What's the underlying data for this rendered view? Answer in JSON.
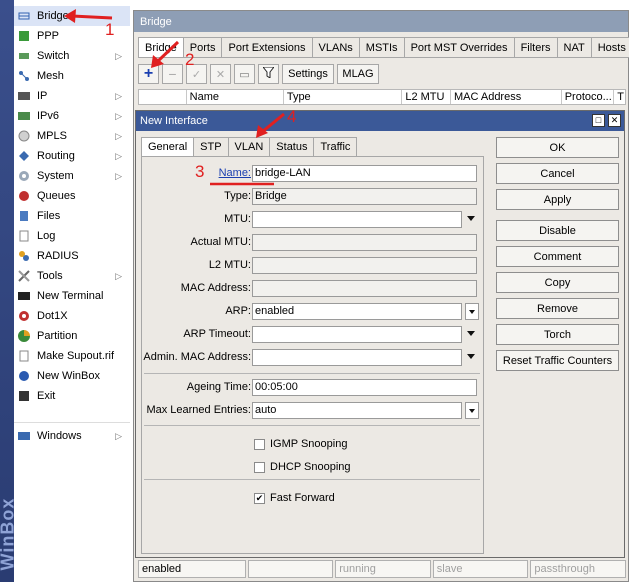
{
  "strip": {
    "brand": "WinBox"
  },
  "menu": {
    "items": [
      {
        "label": "Bridge",
        "icon": "bridge-icon",
        "arrow": false
      },
      {
        "label": "PPP",
        "icon": "ppp-icon",
        "arrow": false
      },
      {
        "label": "Switch",
        "icon": "switch-icon",
        "arrow": true
      },
      {
        "label": "Mesh",
        "icon": "mesh-icon",
        "arrow": false
      },
      {
        "label": "IP",
        "icon": "ip-icon",
        "arrow": true
      },
      {
        "label": "IPv6",
        "icon": "ipv6-icon",
        "arrow": true
      },
      {
        "label": "MPLS",
        "icon": "mpls-icon",
        "arrow": true
      },
      {
        "label": "Routing",
        "icon": "routing-icon",
        "arrow": true
      },
      {
        "label": "System",
        "icon": "system-icon",
        "arrow": true
      },
      {
        "label": "Queues",
        "icon": "queues-icon",
        "arrow": false
      },
      {
        "label": "Files",
        "icon": "files-icon",
        "arrow": false
      },
      {
        "label": "Log",
        "icon": "log-icon",
        "arrow": false
      },
      {
        "label": "RADIUS",
        "icon": "radius-icon",
        "arrow": false
      },
      {
        "label": "Tools",
        "icon": "tools-icon",
        "arrow": true
      },
      {
        "label": "New Terminal",
        "icon": "terminal-icon",
        "arrow": false
      },
      {
        "label": "Dot1X",
        "icon": "dot1x-icon",
        "arrow": false
      },
      {
        "label": "Partition",
        "icon": "partition-icon",
        "arrow": false
      },
      {
        "label": "Make Supout.rif",
        "icon": "supout-icon",
        "arrow": false
      },
      {
        "label": "New WinBox",
        "icon": "winbox-icon",
        "arrow": false
      },
      {
        "label": "Exit",
        "icon": "exit-icon",
        "arrow": false
      }
    ],
    "windows": {
      "label": "Windows",
      "icon": "windows-icon",
      "arrow": true
    }
  },
  "bridge_window": {
    "title": "Bridge",
    "tabs": [
      "Bridge",
      "Ports",
      "Port Extensions",
      "VLANs",
      "MSTIs",
      "Port MST Overrides",
      "Filters",
      "NAT",
      "Hosts"
    ],
    "toolbar": {
      "settings": "Settings",
      "mlag": "MLAG"
    },
    "columns": [
      "",
      "Name",
      "Type",
      "L2 MTU",
      "MAC Address",
      "Protoco...",
      "T"
    ],
    "status": [
      "enabled",
      "",
      "running",
      "slave",
      "passthrough"
    ]
  },
  "dialog": {
    "title": "New Interface",
    "tabs": [
      "General",
      "STP",
      "VLAN",
      "Status",
      "Traffic"
    ],
    "fields": {
      "name": {
        "label": "Name:",
        "value": "bridge-LAN"
      },
      "type": {
        "label": "Type:",
        "value": "Bridge"
      },
      "mtu": {
        "label": "MTU:",
        "value": ""
      },
      "actual_mtu": {
        "label": "Actual MTU:",
        "value": ""
      },
      "l2_mtu": {
        "label": "L2 MTU:",
        "value": ""
      },
      "mac_address": {
        "label": "MAC Address:",
        "value": ""
      },
      "arp": {
        "label": "ARP:",
        "value": "enabled"
      },
      "arp_timeout": {
        "label": "ARP Timeout:",
        "value": ""
      },
      "admin_mac": {
        "label": "Admin. MAC Address:",
        "value": ""
      },
      "ageing_time": {
        "label": "Ageing Time:",
        "value": "00:05:00"
      },
      "max_learned": {
        "label": "Max Learned Entries:",
        "value": "auto"
      }
    },
    "checkboxes": {
      "igmp": {
        "label": "IGMP Snooping",
        "checked": false
      },
      "dhcp": {
        "label": "DHCP Snooping",
        "checked": false
      },
      "fast_forward": {
        "label": "Fast Forward",
        "checked": true
      }
    },
    "buttons": {
      "ok": "OK",
      "cancel": "Cancel",
      "apply": "Apply",
      "disable": "Disable",
      "comment": "Comment",
      "copy": "Copy",
      "remove": "Remove",
      "torch": "Torch",
      "reset": "Reset Traffic Counters"
    }
  },
  "annotations": [
    "1",
    "2",
    "3",
    "4"
  ],
  "colors": {
    "accent": "#3b5998",
    "annotation": "#e02020",
    "add": "#1a3fb0"
  }
}
